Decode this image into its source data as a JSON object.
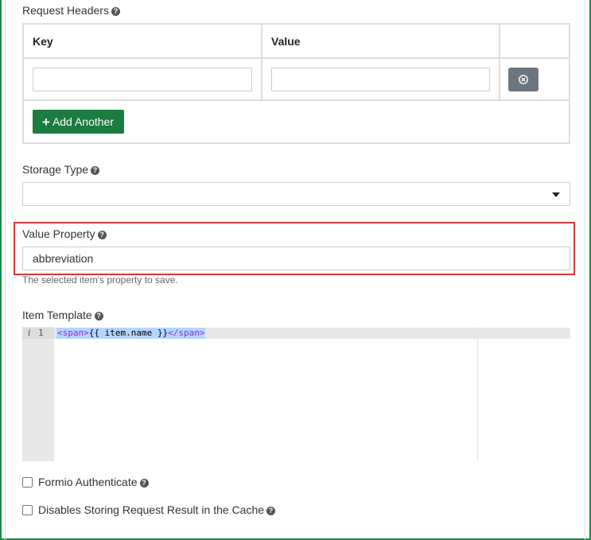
{
  "request_headers": {
    "label": "Request Headers",
    "columns": {
      "key": "Key",
      "value": "Value"
    },
    "rows": [
      {
        "key": "",
        "value": ""
      }
    ],
    "add_button_label": "Add Another"
  },
  "storage_type": {
    "label": "Storage Type",
    "selected": ""
  },
  "value_property": {
    "label": "Value Property",
    "value": "abbreviation",
    "description": "The selected item's property to save."
  },
  "item_template": {
    "label": "Item Template",
    "line_number": "1",
    "code": {
      "open_tag": "<span>",
      "content": "{{ item.name }}",
      "close_tag": "</span>"
    }
  },
  "checkboxes": {
    "formio_authenticate": {
      "label": "Formio Authenticate",
      "checked": false
    },
    "disable_cache": {
      "label": "Disables Storing Request Result in the Cache",
      "checked": false
    }
  },
  "colors": {
    "accent_green": "#1c7c3f",
    "highlight_red": "#d9363e",
    "remove_button": "#6c757d"
  }
}
